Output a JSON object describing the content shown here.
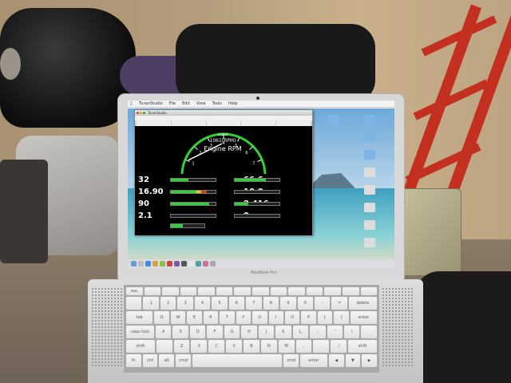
{
  "laptop": {
    "brand": "MacBook Pro"
  },
  "desktop": {
    "menubar": {
      "items": [
        "TunerStudio",
        "File",
        "Edit",
        "View",
        "Tools",
        "Help"
      ],
      "clock": ""
    },
    "icons": [
      {
        "label": ""
      },
      {
        "label": ""
      },
      {
        "label": ""
      },
      {
        "label": ""
      },
      {
        "label": ""
      }
    ]
  },
  "app_window": {
    "title": "TunerStudio",
    "tabs": [
      "",
      "",
      "",
      "",
      ""
    ]
  },
  "dashboard": {
    "tach": {
      "multiplier": "x1000",
      "readout": "1061(RPM)",
      "label": "Engine RPM",
      "tick_labels": [
        "0",
        "1",
        "2",
        "3",
        "4",
        "5",
        "6",
        "7",
        "8"
      ],
      "max": 8,
      "value": 1.061
    },
    "readings": [
      {
        "value": "32",
        "bar": 0.4,
        "colors": [
          "#2fd334"
        ]
      },
      {
        "value": "66.6",
        "bar": 0.7,
        "colors": [
          "#2fd334"
        ]
      },
      {
        "value": "16.90",
        "bar": 0.8,
        "colors": [
          "#2fd334",
          "#d9d21a",
          "#d93a1a"
        ]
      },
      {
        "value": "10.0",
        "bar": 0.0,
        "colors": [
          "#2fd334"
        ]
      },
      {
        "value": "90",
        "bar": 0.85,
        "colors": [
          "#2fd334"
        ]
      },
      {
        "value": "2.416",
        "bar": 0.3,
        "colors": [
          "#2fd334"
        ]
      },
      {
        "value": "2.1",
        "bar": 0.0,
        "colors": [
          "#2fd334"
        ]
      },
      {
        "value": "0",
        "bar": 0.0,
        "colors": [
          "#2fd334"
        ]
      }
    ],
    "status_bar": 0.35,
    "accent": "#2fd334",
    "needle_color": "#ffffff",
    "arc_color": "#2fd334"
  },
  "keyboard": {
    "rows": [
      [
        "esc",
        "",
        "",
        "",
        "",
        "",
        "",
        "",
        "",
        "",
        "",
        "",
        "",
        ""
      ],
      [
        "",
        "1",
        "2",
        "3",
        "4",
        "5",
        "6",
        "7",
        "8",
        "9",
        "0",
        "-",
        "=",
        "delete"
      ],
      [
        "tab",
        "Q",
        "W",
        "E",
        "R",
        "T",
        "Y",
        "U",
        "I",
        "O",
        "P",
        "[",
        "]",
        "enter"
      ],
      [
        "caps lock",
        "A",
        "S",
        "D",
        "F",
        "G",
        "H",
        "J",
        "K",
        "L",
        ";",
        "'",
        "\\",
        ""
      ],
      [
        "shift",
        "`",
        "Z",
        "X",
        "C",
        "V",
        "B",
        "N",
        "M",
        ",",
        ".",
        "/",
        "shift"
      ],
      [
        "fn",
        "ctrl",
        "alt",
        "cmd",
        "",
        "cmd",
        "enter",
        "◀",
        "▼",
        "▶"
      ]
    ]
  }
}
